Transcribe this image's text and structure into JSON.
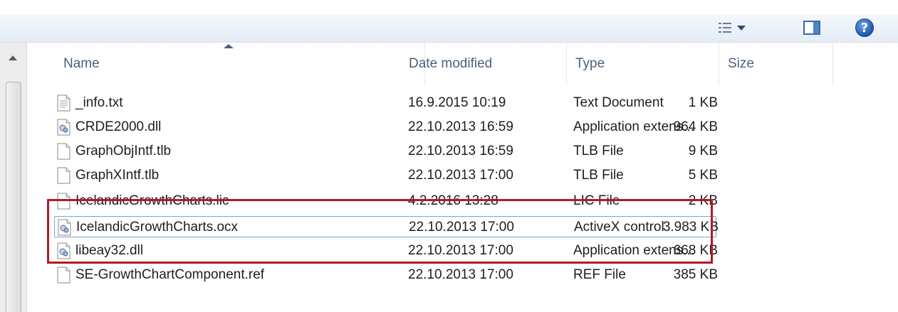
{
  "toolbar": {
    "views_icon": "views-list-icon",
    "preview_icon": "preview-pane-icon",
    "help_icon": "help-icon",
    "help_glyph": "?"
  },
  "columns": {
    "name": "Name",
    "date": "Date modified",
    "type": "Type",
    "size": "Size"
  },
  "files": [
    {
      "name": "_info.txt",
      "date": "16.9.2015 10:19",
      "type": "Text Document",
      "size": "1 KB",
      "icon": "text-file-icon"
    },
    {
      "name": "CRDE2000.dll",
      "date": "22.10.2013 16:59",
      "type": "Application extens...",
      "size": "964 KB",
      "icon": "dll-file-icon"
    },
    {
      "name": "GraphObjIntf.tlb",
      "date": "22.10.2013 16:59",
      "type": "TLB File",
      "size": "9 KB",
      "icon": "blank-file-icon"
    },
    {
      "name": "GraphXIntf.tlb",
      "date": "22.10.2013 17:00",
      "type": "TLB File",
      "size": "5 KB",
      "icon": "blank-file-icon"
    },
    {
      "name": "IcelandicGrowthCharts.lic",
      "date": "4.2.2016 13:28",
      "type": "LIC File",
      "size": "2 KB",
      "icon": "blank-file-icon"
    },
    {
      "name": "IcelandicGrowthCharts.ocx",
      "date": "22.10.2013 17:00",
      "type": "ActiveX control",
      "size": "3.983 KB",
      "icon": "activex-file-icon"
    },
    {
      "name": "libeay32.dll",
      "date": "22.10.2013 17:00",
      "type": "Application extens...",
      "size": "668 KB",
      "icon": "dll-file-icon"
    },
    {
      "name": "SE-GrowthChartComponent.ref",
      "date": "22.10.2013 17:00",
      "type": "REF File",
      "size": "385 KB",
      "icon": "blank-file-icon"
    }
  ],
  "colors": {
    "highlight": "#b21b24",
    "selection": "#7da2ce",
    "header_text": "#4c607a"
  }
}
